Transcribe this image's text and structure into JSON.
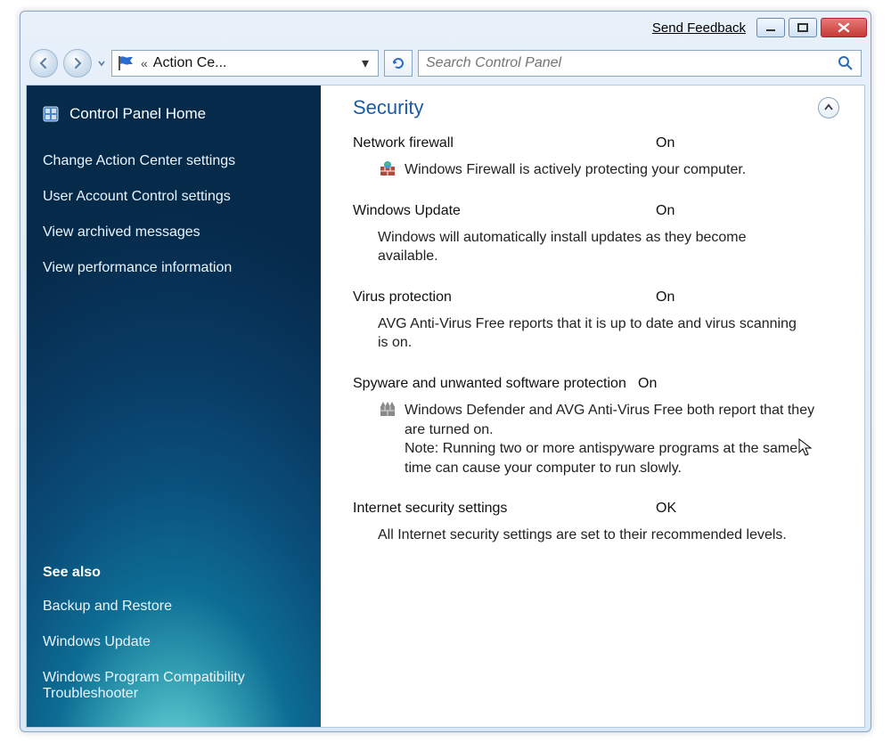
{
  "titlebar": {
    "feedback": "Send Feedback"
  },
  "nav": {
    "breadcrumb": "Action Ce...",
    "search_placeholder": "Search Control Panel"
  },
  "sidebar": {
    "home": "Control Panel Home",
    "links": [
      "Change Action Center settings",
      "User Account Control settings",
      "View archived messages",
      "View performance information"
    ],
    "see_also_heading": "See also",
    "see_also": [
      "Backup and Restore",
      "Windows Update",
      "Windows Program Compatibility Troubleshooter"
    ]
  },
  "main": {
    "section_title": "Security",
    "items": [
      {
        "label": "Network firewall",
        "status": "On",
        "icon": "firewall-icon",
        "desc": "Windows Firewall is actively protecting your computer."
      },
      {
        "label": "Windows Update",
        "status": "On",
        "icon": "",
        "desc": "Windows will automatically install updates as they become available."
      },
      {
        "label": "Virus protection",
        "status": "On",
        "icon": "",
        "desc": "AVG Anti-Virus Free reports that it is up to date and virus scanning is on."
      },
      {
        "label": "Spyware and unwanted software protection",
        "status": "On",
        "icon": "defender-icon",
        "desc": "Windows Defender and AVG Anti-Virus Free both report that they are turned on.",
        "note": "Note: Running two or more antispyware programs at the same time can cause your computer to run slowly."
      },
      {
        "label": "Internet security settings",
        "status": "OK",
        "icon": "",
        "desc": "All Internet security settings are set to their recommended levels."
      }
    ]
  }
}
